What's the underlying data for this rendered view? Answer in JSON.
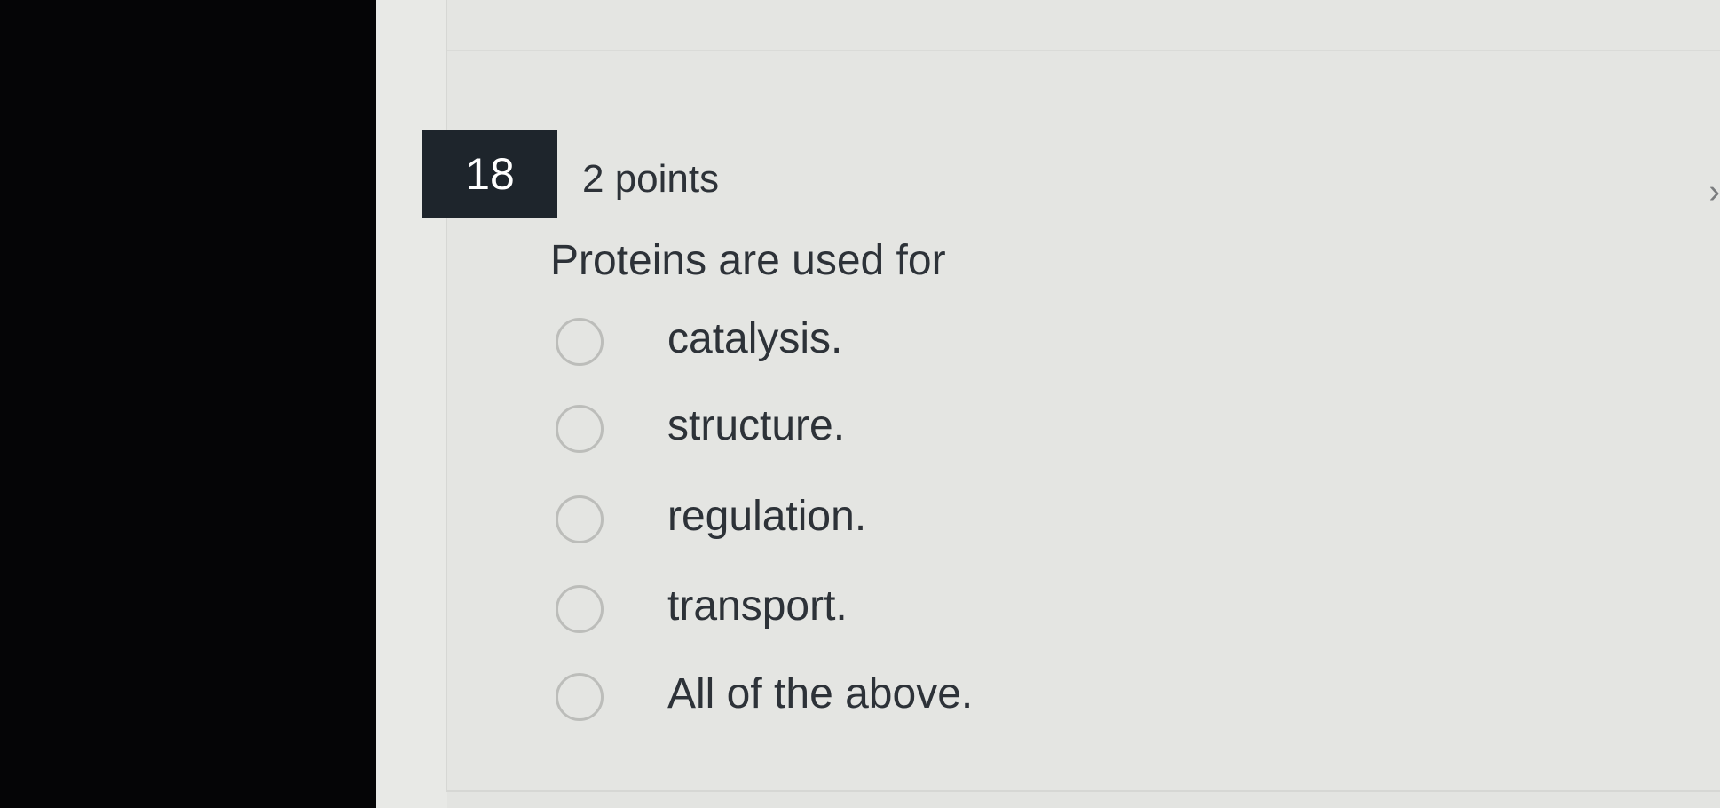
{
  "question": {
    "number": "18",
    "points": "2 points",
    "prompt": "Proteins are used for"
  },
  "options": [
    {
      "label": "catalysis."
    },
    {
      "label": "structure."
    },
    {
      "label": "regulation."
    },
    {
      "label": "transport."
    },
    {
      "label": "All of the above."
    }
  ],
  "edge_chevron": "›"
}
